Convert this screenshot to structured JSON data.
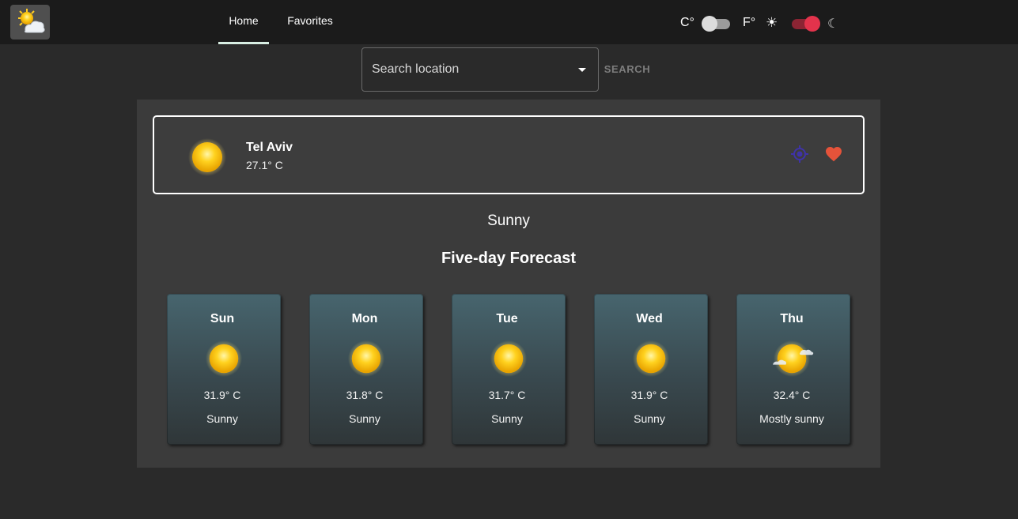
{
  "nav": {
    "tabs": [
      {
        "label": "Home",
        "active": true
      },
      {
        "label": "Favorites",
        "active": false
      }
    ]
  },
  "header": {
    "unit_c_label": "C°",
    "unit_f_label": "F°",
    "sun_icon": "☀",
    "moon_icon": "☾",
    "units_toggle_on": false,
    "dark_mode_on": true
  },
  "search": {
    "placeholder": "Search location",
    "button_label": "SEARCH"
  },
  "current": {
    "city": "Tel Aviv",
    "temperature": "27.1° C",
    "condition": "Sunny",
    "icon": "sun-icon"
  },
  "forecast": {
    "title": "Five-day Forecast",
    "days": [
      {
        "day": "Sun",
        "temp": "31.9° C",
        "condition": "Sunny",
        "icon": "sun-icon"
      },
      {
        "day": "Mon",
        "temp": "31.8° C",
        "condition": "Sunny",
        "icon": "sun-icon"
      },
      {
        "day": "Tue",
        "temp": "31.7° C",
        "condition": "Sunny",
        "icon": "sun-icon"
      },
      {
        "day": "Wed",
        "temp": "31.9° C",
        "condition": "Sunny",
        "icon": "sun-icon"
      },
      {
        "day": "Thu",
        "temp": "32.4° C",
        "condition": "Mostly sunny",
        "icon": "sun-cloud-icon"
      }
    ]
  },
  "colors": {
    "topbar": "#1b1b1b",
    "background": "#2a2a2a",
    "panel": "#3b3b3b",
    "theme_toggle": "#e3334c",
    "favorite_heart": "#e5533a",
    "location_icon": "#3f33a8"
  }
}
